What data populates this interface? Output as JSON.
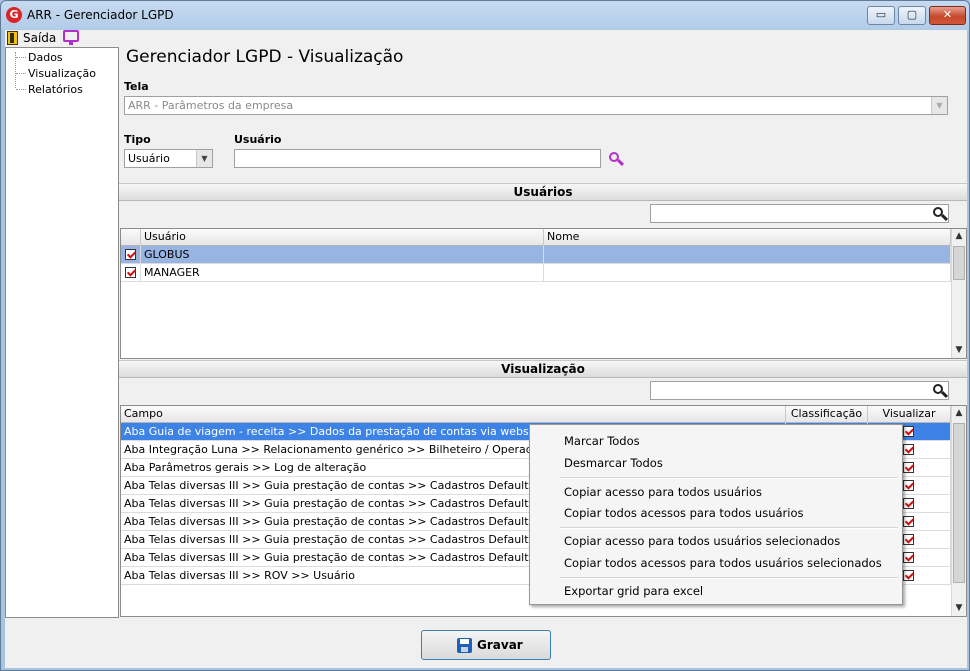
{
  "window": {
    "title": "ARR - Gerenciador LGPD",
    "app_icon": "G",
    "minimize": "▭",
    "maximize": "▢",
    "close": "✕"
  },
  "menubar": {
    "saida": "Saída"
  },
  "tree": {
    "items": [
      "Dados",
      "Visualização",
      "Relatórios"
    ]
  },
  "page": {
    "title": "Gerenciador LGPD - Visualização"
  },
  "tela": {
    "label": "Tela",
    "value": "ARR - Parâmetros da empresa"
  },
  "tipo": {
    "label": "Tipo",
    "value": "Usuário"
  },
  "usuario": {
    "label": "Usuário",
    "value": ""
  },
  "usuarios_section": {
    "title": "Usuários",
    "search_value": "",
    "columns": [
      "Usuário",
      "Nome"
    ],
    "rows": [
      {
        "usuario": "GLOBUS",
        "nome": "",
        "checked": true
      },
      {
        "usuario": "MANAGER",
        "nome": "",
        "checked": true
      }
    ]
  },
  "visualizacao_section": {
    "title": "Visualização",
    "search_value": "",
    "columns": [
      "Campo",
      "Classificação",
      "Visualizar"
    ],
    "rows": [
      {
        "campo": "Aba Guia de viagem - receita >> Dados da prestação de contas via webservice >> Us",
        "classificacao": "",
        "visualizar": true
      },
      {
        "campo": "Aba Integração Luna >> Relacionamento genérico >> Bilheteiro / Operador >> Browse",
        "classificacao": "",
        "visualizar": true
      },
      {
        "campo": "Aba Parâmetros gerais >> Log de alteração",
        "classificacao": "",
        "visualizar": true
      },
      {
        "campo": "Aba Telas diversas III >> Guia prestação de contas >> Cadastros Default >> Motorista",
        "classificacao": "",
        "visualizar": true
      },
      {
        "campo": "Aba Telas diversas III >> Guia prestação de contas >> Cadastros Default >> Motorista",
        "classificacao": "",
        "visualizar": true
      },
      {
        "campo": "Aba Telas diversas III >> Guia prestação de contas >> Cadastros Default >> Motorista",
        "classificacao": "",
        "visualizar": true
      },
      {
        "campo": "Aba Telas diversas III >> Guia prestação de contas >> Cadastros Default >> Motorista",
        "classificacao": "",
        "visualizar": true
      },
      {
        "campo": "Aba Telas diversas III >> Guia prestação de contas >> Cadastros Default >> Motorista",
        "classificacao": "",
        "visualizar": true
      },
      {
        "campo": "Aba Telas diversas III >> ROV >> Usuário",
        "classificacao": "",
        "visualizar": true
      }
    ]
  },
  "context_menu": {
    "items": [
      "Marcar Todos",
      "Desmarcar Todos",
      "Copiar acesso para todos usuários",
      "Copiar todos acessos para todos usuários",
      "Copiar acesso para todos usuários selecionados",
      "Copiar todos acessos para todos usuários selecionados",
      "Exportar grid para excel"
    ]
  },
  "gravar_button": {
    "label": "Gravar"
  },
  "icons": {
    "saida": "door-exit-icon",
    "monitor": "monitor-icon",
    "search": "search-icon",
    "save": "floppy-disk-icon"
  },
  "colors": {
    "selection": "#98b4e3",
    "focus_row": "#3d83e6",
    "check": "#d01010",
    "accent": "#b22fcf"
  }
}
